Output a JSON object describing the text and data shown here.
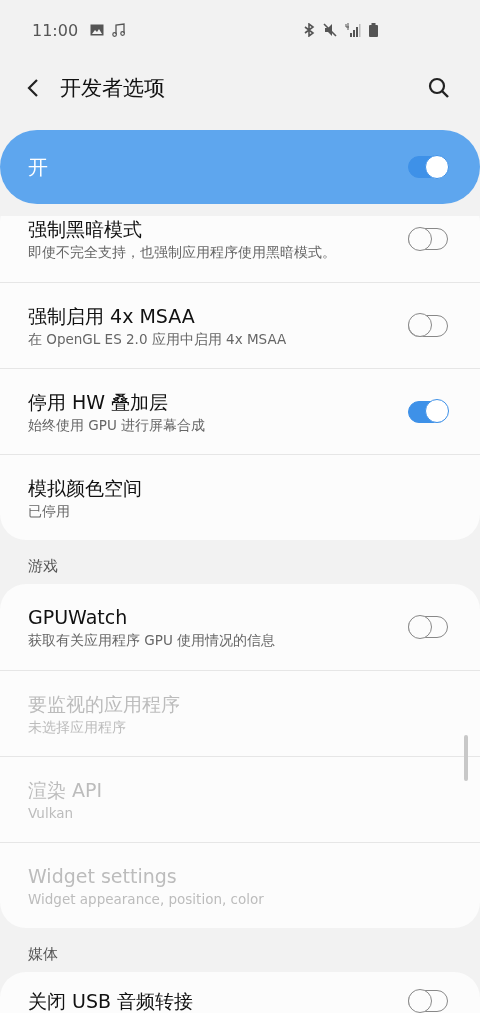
{
  "status_bar": {
    "time": "11:00"
  },
  "header": {
    "title": "开发者选项"
  },
  "master_switch": {
    "label": "开",
    "on": true
  },
  "sections": [
    {
      "items": [
        {
          "kind": "toggle",
          "title": "强制黑暗模式",
          "subtitle": "即使不完全支持，也强制应用程序使用黑暗模式。",
          "on": false,
          "disabled": false
        },
        {
          "kind": "toggle",
          "title": "强制启用 4x MSAA",
          "subtitle": "在 OpenGL ES 2.0 应用中启用 4x MSAA",
          "on": false,
          "disabled": false
        },
        {
          "kind": "toggle",
          "title": "停用 HW 叠加层",
          "subtitle": "始终使用 GPU 进行屏幕合成",
          "on": true,
          "disabled": false
        },
        {
          "kind": "plain",
          "title": "模拟颜色空间",
          "subtitle": "已停用",
          "disabled": false
        }
      ]
    },
    {
      "header": "游戏",
      "items": [
        {
          "kind": "toggle",
          "title": "GPUWatch",
          "subtitle": "获取有关应用程序 GPU 使用情况的信息",
          "on": false,
          "disabled": false
        },
        {
          "kind": "plain",
          "title": "要监视的应用程序",
          "subtitle": "未选择应用程序",
          "disabled": true
        },
        {
          "kind": "plain",
          "title": "渲染 API",
          "subtitle": "Vulkan",
          "disabled": true
        },
        {
          "kind": "plain",
          "title": "Widget settings",
          "subtitle": "Widget appearance, position, color",
          "disabled": true
        }
      ]
    },
    {
      "header": "媒体",
      "items": [
        {
          "kind": "toggle",
          "title": "关闭 USB 音频转接",
          "on": false,
          "disabled": false
        }
      ]
    }
  ]
}
